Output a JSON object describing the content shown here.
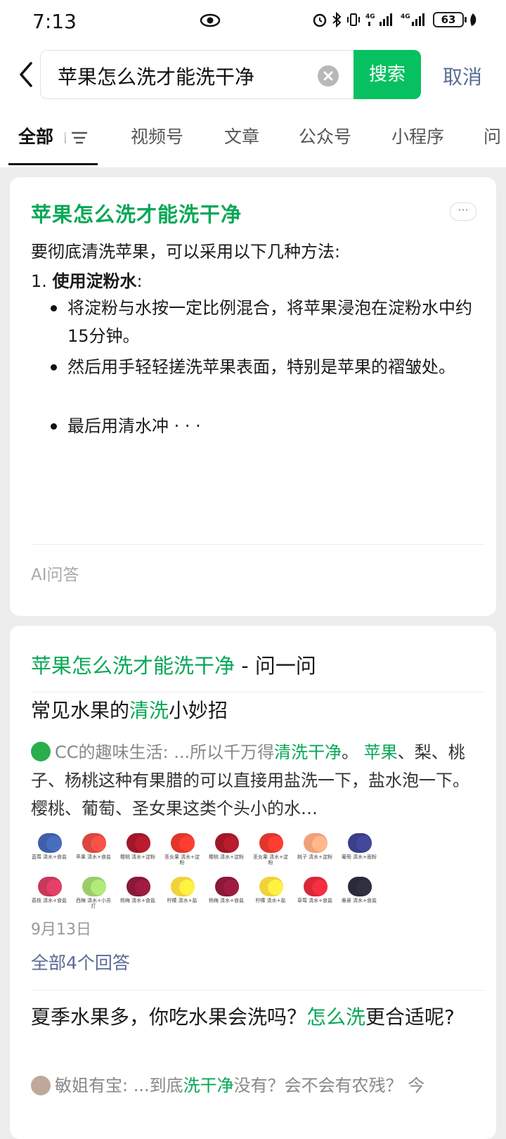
{
  "status_bar": {
    "time": "7:13",
    "battery": "63"
  },
  "search": {
    "query": "苹果怎么洗才能洗干净",
    "button": "搜索",
    "cancel": "取消"
  },
  "tabs": [
    {
      "label": "全部"
    },
    {
      "label": "视频号"
    },
    {
      "label": "文章"
    },
    {
      "label": "公众号"
    },
    {
      "label": "小程序"
    },
    {
      "label": "问"
    }
  ],
  "ai_card": {
    "title": "苹果怎么洗才能洗干净",
    "more": "···",
    "intro": "要彻底清洗苹果，可以采用以下几种方法:",
    "step_num": "1.",
    "step_bold": "使用淀粉水",
    "step_colon": ":",
    "bullets": [
      "将淀粉与水按一定比例混合，将苹果浸泡在淀粉水中约15分钟。",
      "然后用手轻轻搓洗苹果表面，特别是苹果的褶皱处。",
      "最后用清水冲 · · ·"
    ],
    "footer": "AI问答"
  },
  "qa_card": {
    "title_green": "苹果怎么洗才能洗干净",
    "title_rest": " - 问一问",
    "q1": {
      "title_a": "常见水果的",
      "title_hl": "清洗",
      "title_b": "小妙招",
      "source": "CC的趣味生活:",
      "s1": " ...所以千万得",
      "s1_hl": "清洗干净",
      "s2": "。 ",
      "s2_hl": "苹果",
      "s3": "、梨、桃子、杨桃这种有果腊的可以直接用盐洗一下，盐水泡一下。 樱桃、葡萄、圣女果这类个头小的水…",
      "fruits": [
        {
          "name": "蓝莓",
          "tip": "清水+食盐",
          "color": "#3f5fa8"
        },
        {
          "name": "苹果",
          "tip": "清水+食盐",
          "color": "#d9473f"
        },
        {
          "name": "樱桃",
          "tip": "清水+淀粉",
          "color": "#a01828"
        },
        {
          "name": "圣女果",
          "tip": "清水+淀粉",
          "color": "#e0362b"
        },
        {
          "name": "樱桃",
          "tip": "清水+淀粉",
          "color": "#a01828"
        },
        {
          "name": "圣女果",
          "tip": "清水+淀粉",
          "color": "#e0362b"
        },
        {
          "name": "桃子",
          "tip": "清水+淀粉",
          "color": "#f0a07a"
        },
        {
          "name": "葡萄",
          "tip": "清水+面粉",
          "color": "#3b3f86"
        },
        {
          "name": "荔枝",
          "tip": "清水+食盐",
          "color": "#c8385a"
        },
        {
          "name": "西梅",
          "tip": "清水+小苏打",
          "color": "#9acd6a"
        },
        {
          "name": "杨梅",
          "tip": "清水+食盐",
          "color": "#8a1838"
        },
        {
          "name": "柠檬",
          "tip": "清水+盐",
          "color": "#f2d23a"
        },
        {
          "name": "杨梅",
          "tip": "清水+食盐",
          "color": "#8a1838"
        },
        {
          "name": "柠檬",
          "tip": "清水+盐",
          "color": "#f2d23a"
        },
        {
          "name": "草莓",
          "tip": "清水+食盐",
          "color": "#d8283a"
        },
        {
          "name": "桑葚",
          "tip": "清水+食盐",
          "color": "#2a2a38"
        }
      ],
      "date": "9月13日",
      "all_answers": "全部4个回答"
    },
    "q2": {
      "title_a": "夏季水果多，你吃水果会洗吗？",
      "title_hl": "怎么洗",
      "title_b": "更合适呢?",
      "source": "敏姐有宝:",
      "s1": " ...到底",
      "s1_hl": "洗干净",
      "s2": "没有？会不会有农残？ 今"
    }
  }
}
